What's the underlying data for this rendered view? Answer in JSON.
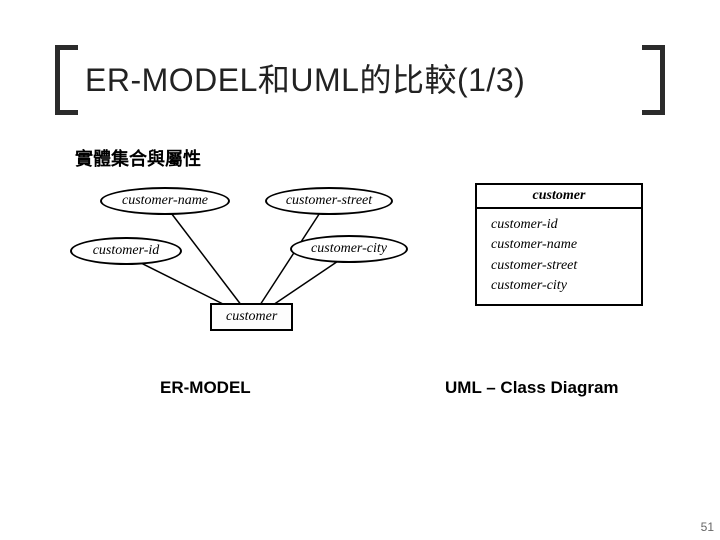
{
  "title": "ER-MODEL和UML的比較(1/3)",
  "subtitle": "實體集合與屬性",
  "er": {
    "entity": "customer",
    "attrs": {
      "name": "customer-name",
      "id": "customer-id",
      "street": "customer-street",
      "city": "customer-city"
    },
    "caption": "ER-MODEL"
  },
  "uml": {
    "class_name": "customer",
    "attrs": [
      "customer-id",
      "customer-name",
      "customer-street",
      "customer-city"
    ],
    "caption": "UML – Class Diagram"
  },
  "page_number": "51"
}
